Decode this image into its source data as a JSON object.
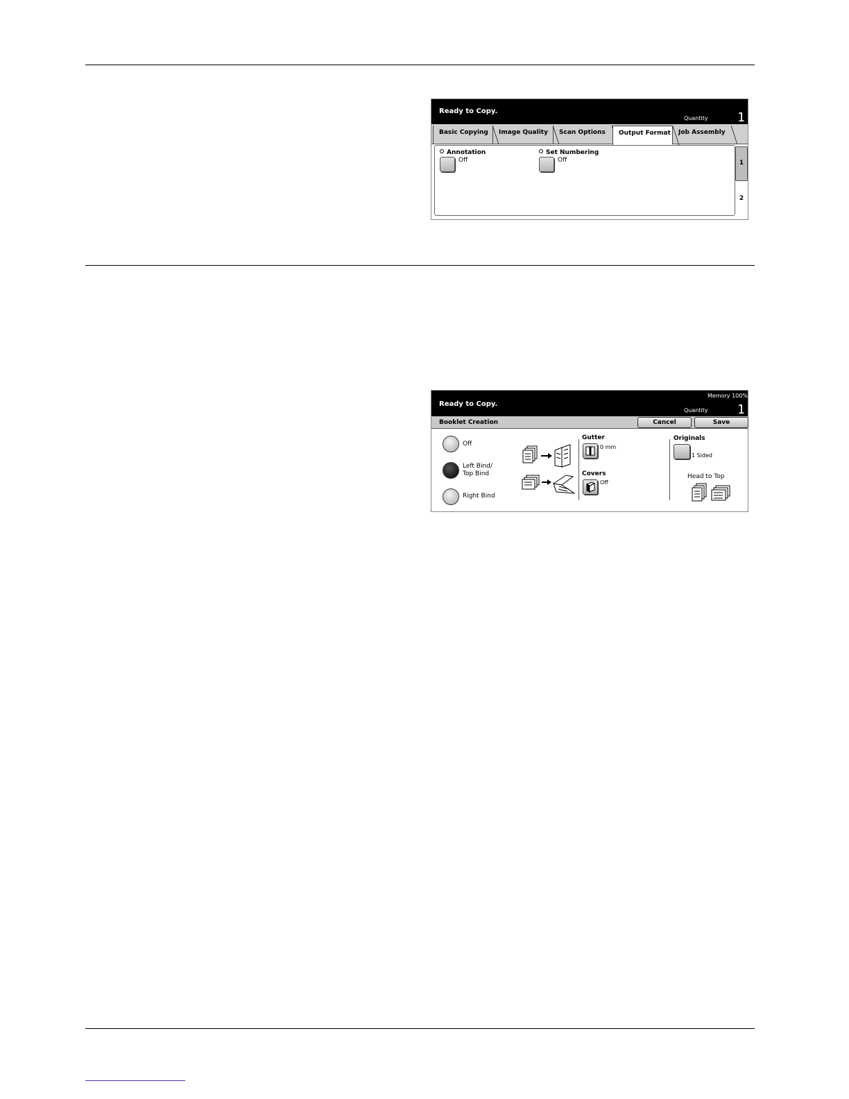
{
  "panel_output_format": {
    "status": "Ready to Copy.",
    "quantity_label": "Quantity",
    "quantity_value": "1",
    "tabs": [
      {
        "label": "Basic Copying"
      },
      {
        "label": "Image Quality"
      },
      {
        "label": "Scan Options"
      },
      {
        "label": "Output Format",
        "active": true
      },
      {
        "label": "Job Assembly"
      }
    ],
    "features": {
      "annotation": {
        "label": "Annotation",
        "value": "Off"
      },
      "set_numbering": {
        "label": "Set Numbering",
        "value": "Off"
      }
    },
    "pages": [
      "1",
      "2"
    ]
  },
  "panel_booklet": {
    "memory": "Memory 100%",
    "status": "Ready to Copy.",
    "quantity_label": "Quantity",
    "quantity_value": "1",
    "title": "Booklet Creation",
    "cancel_label": "Cancel",
    "save_label": "Save",
    "options": {
      "off": "Off",
      "left_bind_line1": "Left Bind/",
      "left_bind_line2": "Top Bind",
      "right_bind": "Right Bind",
      "selected": "left_bind"
    },
    "gutter": {
      "label": "Gutter",
      "value": "0 mm"
    },
    "covers": {
      "label": "Covers",
      "value": "Off"
    },
    "originals": {
      "label": "Originals",
      "value": "1 Sided",
      "orientation": "Head to Top"
    }
  }
}
